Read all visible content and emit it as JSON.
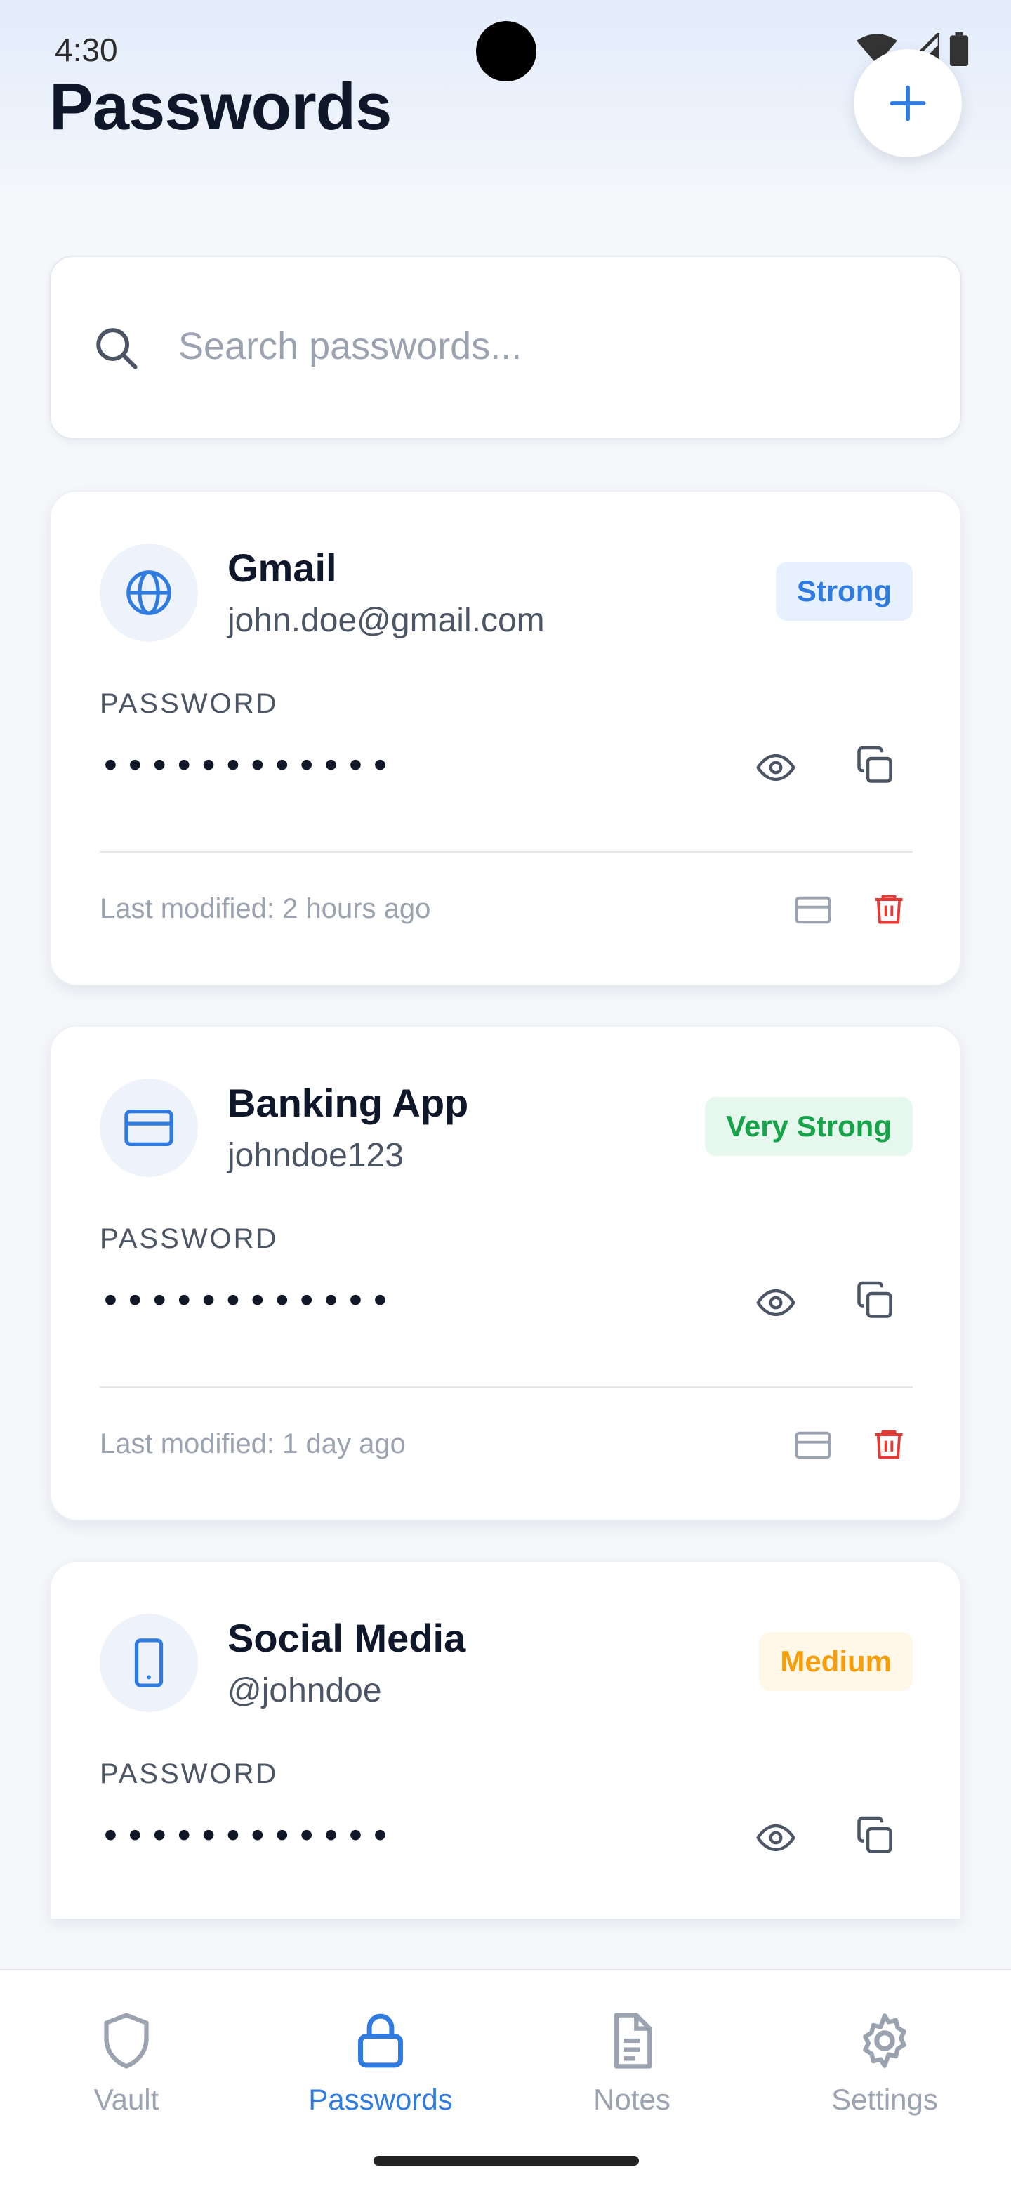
{
  "status_bar": {
    "time": "4:30"
  },
  "header": {
    "title": "Passwords"
  },
  "search": {
    "placeholder": "Search passwords..."
  },
  "entries": [
    {
      "name": "Gmail",
      "username": "john.doe@gmail.com",
      "strength": "Strong",
      "password_label": "PASSWORD",
      "masked_password": "••••••••••••",
      "modified": "Last modified: 2 hours ago",
      "icon": "globe-icon"
    },
    {
      "name": "Banking App",
      "username": "johndoe123",
      "strength": "Very Strong",
      "password_label": "PASSWORD",
      "masked_password": "••••••••••••",
      "modified": "Last modified: 1 day ago",
      "icon": "credit-card-icon"
    },
    {
      "name": "Social Media",
      "username": "@johndoe",
      "strength": "Medium",
      "password_label": "PASSWORD",
      "masked_password": "••••••••••••",
      "icon": "smartphone-icon"
    }
  ],
  "nav": [
    {
      "label": "Vault",
      "icon": "shield-icon",
      "active": false
    },
    {
      "label": "Passwords",
      "icon": "lock-icon",
      "active": true
    },
    {
      "label": "Notes",
      "icon": "document-icon",
      "active": false
    },
    {
      "label": "Settings",
      "icon": "gear-icon",
      "active": false
    }
  ],
  "colors": {
    "accent": "#2f7be0",
    "strong_bg": "#e7f0fd",
    "very_strong_text": "#16a34a",
    "very_strong_bg": "#e6f7ee",
    "medium_text": "#f59e0b",
    "medium_bg": "#fff7e8",
    "danger": "#e53935"
  }
}
